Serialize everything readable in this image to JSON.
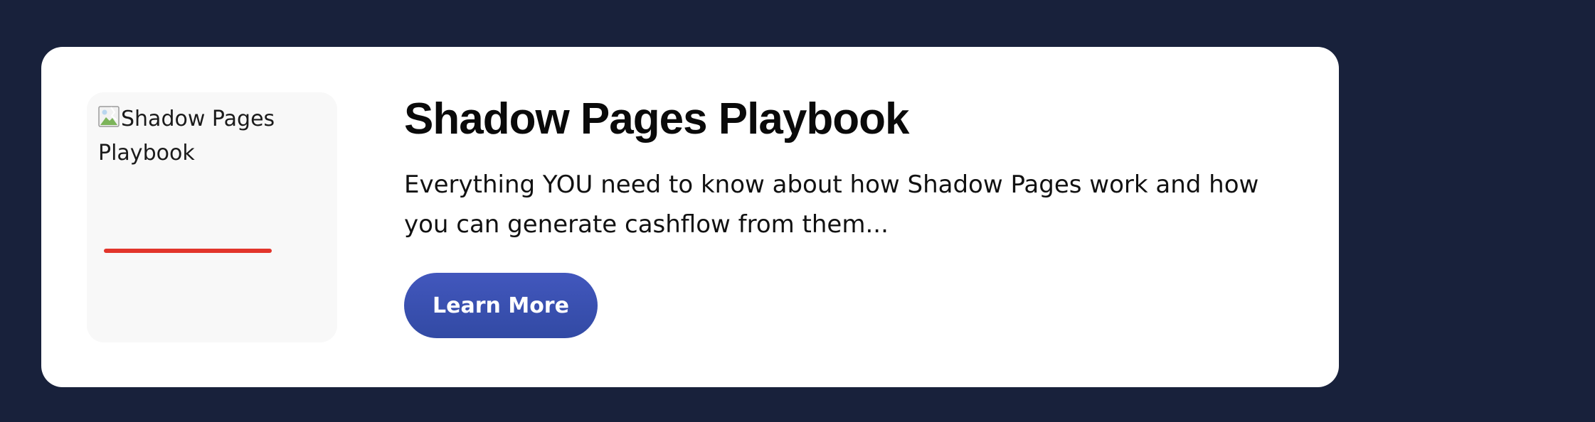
{
  "card": {
    "image": {
      "alt_text": "Shadow Pages Playbook",
      "icon": "broken-image-icon",
      "underline_color": "#e2352b"
    },
    "title": "Shadow Pages Playbook",
    "description": "Everything YOU need to know about how Shadow Pages work and how you can generate cashflow from them...",
    "cta_label": "Learn More"
  },
  "colors": {
    "page_background": "#18213b",
    "card_background": "#ffffff",
    "thumb_background": "#f8f8f8",
    "button": "#3a50b0"
  }
}
